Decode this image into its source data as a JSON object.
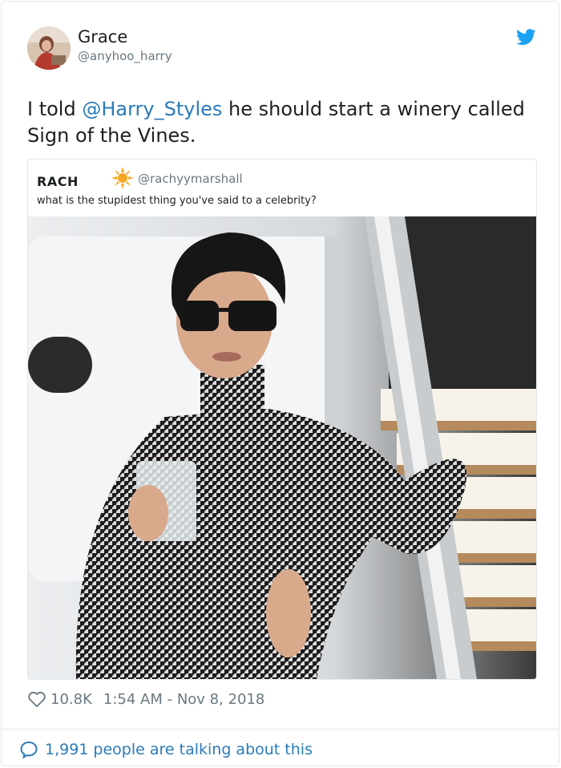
{
  "tweet": {
    "author_name": "Grace",
    "author_handle": "@anyhoo_harry",
    "text_before": "I told ",
    "mention": "@Harry_Styles",
    "text_after": " he should start a winery called Sign of the Vines.",
    "likes": "10.8K",
    "timestamp": "1:54 AM - Nov 8, 2018",
    "talking": "1,991 people are talking about this",
    "bird_icon": "twitter-bird-icon",
    "heart_icon": "heart-icon",
    "bubble_icon": "speech-bubble-icon"
  },
  "quoted": {
    "name": "RACH",
    "emoji_icon": "sun-emoji-icon",
    "handle": "@rachyymarshall",
    "text": "what is the stupidest thing you've said to a celebrity?"
  },
  "colors": {
    "link": "#2b7bb9",
    "muted": "#697882",
    "border": "#e1e8ed",
    "bird": "#1da1f2",
    "sun": "#f5a623"
  }
}
